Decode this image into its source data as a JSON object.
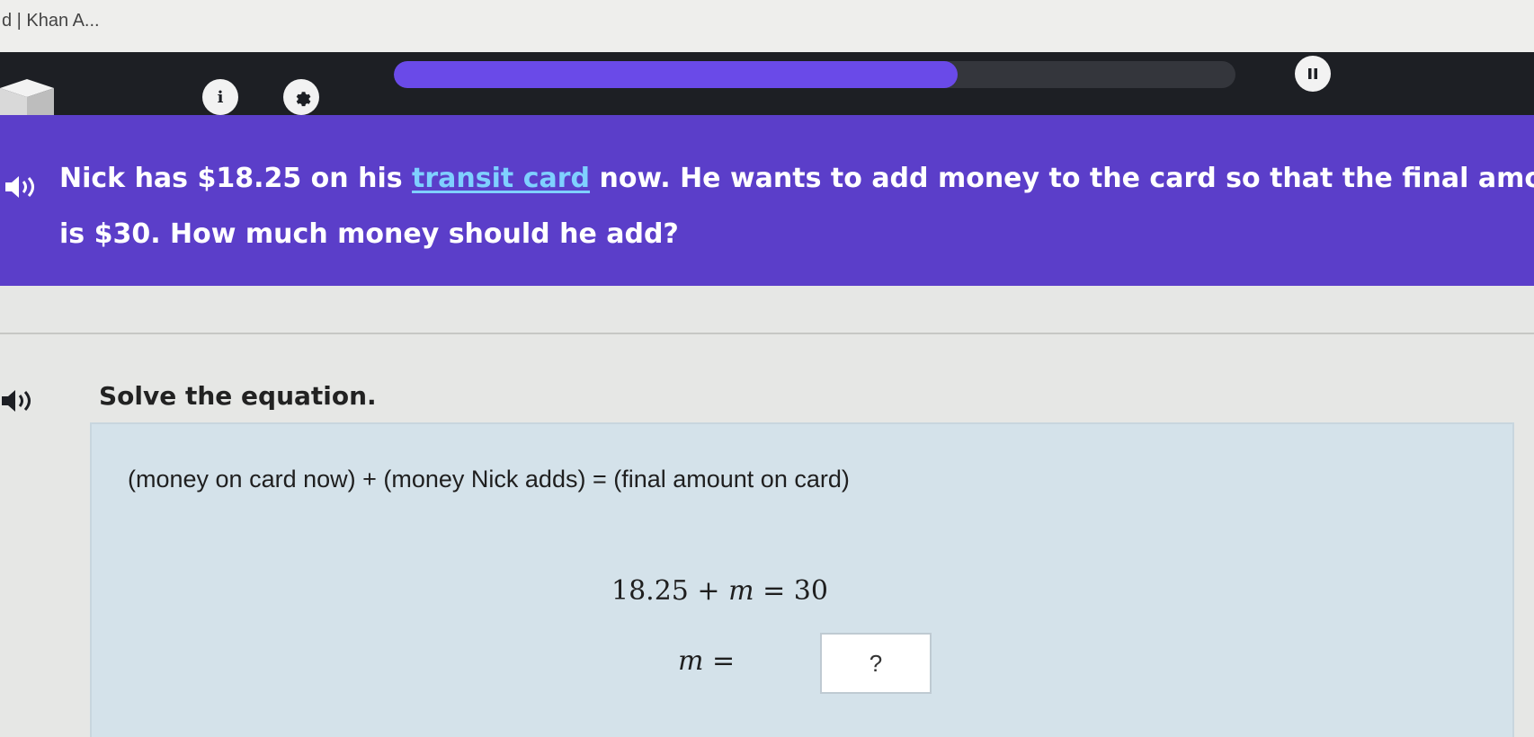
{
  "browser": {
    "tab_title": "d | Khan A..."
  },
  "topbar": {
    "info_glyph": "i",
    "progress_fraction": 0.67,
    "colors": {
      "bar_bg": "#1d1f24",
      "progress_fill": "#6a4ae8",
      "progress_track": "#34363c"
    }
  },
  "question": {
    "line1_before": "Nick has $18.25 on his ",
    "glossary_term": "transit card",
    "line1_after": " now. He wants to add money to the card so that the final amount",
    "line2": "is $30. How much money should he add?",
    "band_color": "#5b3ec9"
  },
  "instruction": "Solve the equation.",
  "equation": {
    "word_equation": "(money on card now) + (money Nick adds) = (final amount on card)",
    "line_a": "18.25",
    "op_plus": " + ",
    "variable": "m",
    "op_equals": " = ",
    "rhs": "30",
    "answer_label_var": "m",
    "answer_label_equals": " =",
    "answer_placeholder": "?"
  },
  "icons": [
    "cube-logo-icon",
    "info-icon",
    "gear-icon",
    "pause-icon",
    "speaker-icon"
  ]
}
